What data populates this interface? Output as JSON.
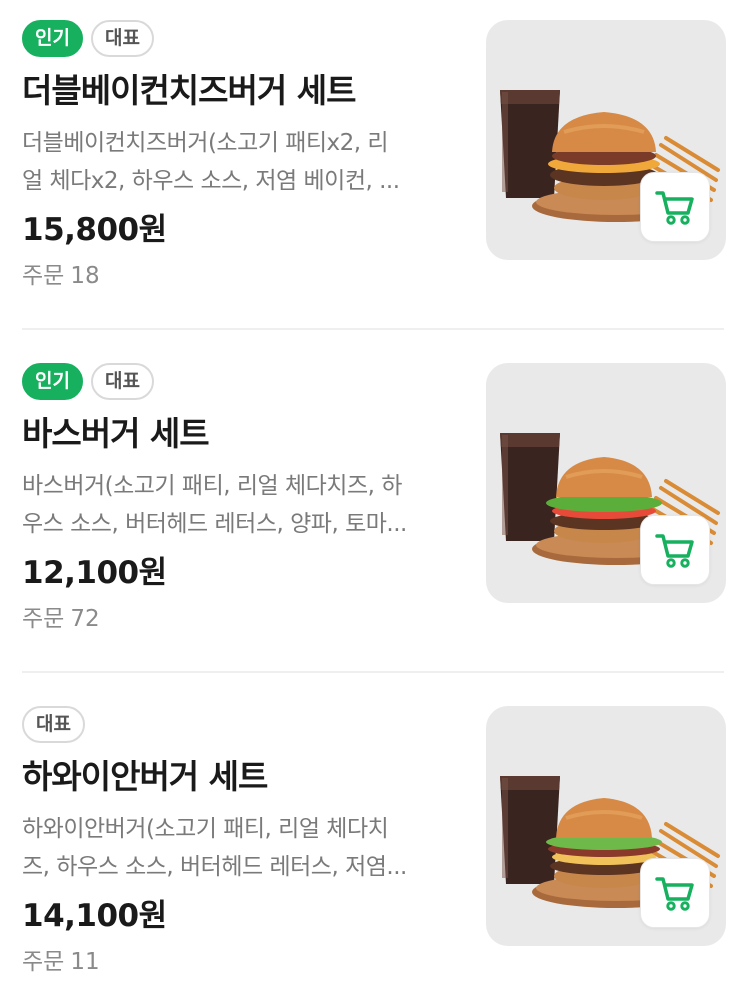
{
  "menu_items": [
    {
      "badges": [
        "인기",
        "대표"
      ],
      "name": "더블베이컨치즈버거 세트",
      "description_line1": "더블베이컨치즈버거(소고기 패티x2, 리",
      "description_line2": "얼 체다x2, 하우스 소스, 저염 베이컨, ...",
      "price": "15,800원",
      "orders_label": "주문",
      "orders_count": "18"
    },
    {
      "badges": [
        "인기",
        "대표"
      ],
      "name": "바스버거 세트",
      "description_line1": "바스버거(소고기 패티, 리얼 체다치즈, 하",
      "description_line2": "우스 소스, 버터헤드 레터스, 양파, 토마...",
      "price": "12,100원",
      "orders_label": "주문",
      "orders_count": "72"
    },
    {
      "badges": [
        "대표"
      ],
      "name": "하와이안버거 세트",
      "description_line1": "하와이안버거(소고기 패티, 리얼 체다치",
      "description_line2": "즈, 하우스 소스, 버터헤드 레터스, 저염...",
      "price": "14,100원",
      "orders_label": "주문",
      "orders_count": "11"
    }
  ],
  "icons": {
    "cart": "shopping-cart-icon"
  },
  "colors": {
    "accent": "#16b05e",
    "thumb_bg": "#e9e9e9",
    "muted_text": "#7a7a7a"
  }
}
